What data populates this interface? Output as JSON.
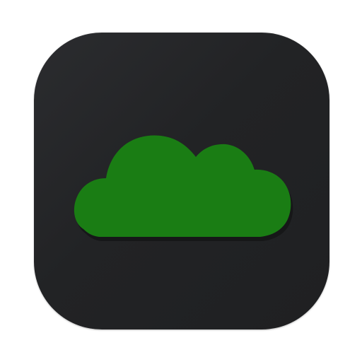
{
  "app_icon": {
    "icon": "cloud-icon",
    "colors": {
      "background": "#242527",
      "cloud": "#1a7d14",
      "cloud_shadow": "#161718"
    }
  }
}
